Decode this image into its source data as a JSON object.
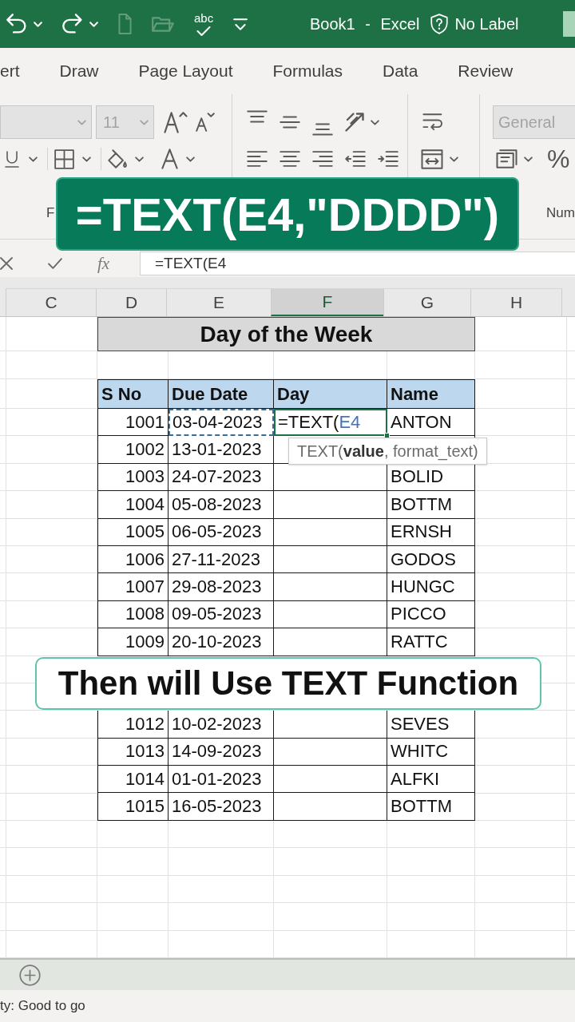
{
  "title_bar": {
    "quick_access": [
      {
        "kind": "undo",
        "disabled": false
      },
      {
        "kind": "redo",
        "disabled": false
      },
      {
        "kind": "new",
        "disabled": true
      },
      {
        "kind": "open",
        "disabled": true
      },
      {
        "kind": "spelling",
        "label": "abc",
        "disabled": false
      },
      {
        "kind": "customize",
        "disabled": false
      }
    ],
    "title": "Book1 - Excel",
    "sensitivity_label": "No Label"
  },
  "ribbon": {
    "tabs": [
      {
        "label": "ert",
        "selected": false
      },
      {
        "label": "Draw",
        "selected": false
      },
      {
        "label": "Page Layout",
        "selected": false
      },
      {
        "label": "Formulas",
        "selected": false
      },
      {
        "label": "Data",
        "selected": false
      },
      {
        "label": "Review",
        "selected": false
      }
    ],
    "font_name": {
      "disabled": true
    },
    "font_size": {
      "value": "11",
      "disabled": true
    },
    "number_format": {
      "value": "General",
      "disabled": true
    },
    "percent_style": "%",
    "group_labels": [
      "F",
      "Num"
    ]
  },
  "formula_caption": "=TEXT(E4,\"DDDD\")",
  "formula_bar": {
    "insert_function": "fx",
    "value": "=TEXT(E4"
  },
  "columns": [
    {
      "label": "C",
      "selected": false
    },
    {
      "label": "D",
      "selected": false
    },
    {
      "label": "E",
      "selected": false
    },
    {
      "label": "F",
      "selected": true
    },
    {
      "label": "G",
      "selected": false
    },
    {
      "label": "H",
      "selected": false
    }
  ],
  "sheet": {
    "title": "Day of the Week",
    "headers": [
      "S No",
      "Due Date",
      "Day",
      "Name"
    ],
    "rows": [
      {
        "s_no": "1001",
        "due_date": "03-04-2023",
        "referenced": true,
        "active": true,
        "day_formula": "=TEXT(",
        "day_reference": "E4",
        "name": "ANTON"
      },
      {
        "s_no": "1002",
        "due_date": "13-01-2023",
        "referenced": false,
        "active": false
      },
      {
        "s_no": "1003",
        "due_date": "24-07-2023",
        "referenced": false,
        "active": false,
        "name": "BOLID"
      },
      {
        "s_no": "1004",
        "due_date": "05-08-2023",
        "referenced": false,
        "active": false,
        "name": "BOTTM"
      },
      {
        "s_no": "1005",
        "due_date": "06-05-2023",
        "referenced": false,
        "active": false,
        "name": "ERNSH"
      },
      {
        "s_no": "1006",
        "due_date": "27-11-2023",
        "referenced": false,
        "active": false,
        "name": "GODOS"
      },
      {
        "s_no": "1007",
        "due_date": "29-08-2023",
        "referenced": false,
        "active": false,
        "name": "HUNGC"
      },
      {
        "s_no": "1008",
        "due_date": "09-05-2023",
        "referenced": false,
        "active": false,
        "name": "PICCO"
      },
      {
        "s_no": "1009",
        "due_date": "20-10-2023",
        "referenced": false,
        "active": false,
        "name": "RATTC"
      },
      {
        "s_no": "1012",
        "due_date": "10-02-2023",
        "referenced": false,
        "active": false,
        "name": "SEVES"
      },
      {
        "s_no": "1013",
        "due_date": "14-09-2023",
        "referenced": false,
        "active": false,
        "name": "WHITC"
      },
      {
        "s_no": "1014",
        "due_date": "01-01-2023",
        "referenced": false,
        "active": false,
        "name": "ALFKI"
      },
      {
        "s_no": "1015",
        "due_date": "16-05-2023",
        "referenced": false,
        "active": false,
        "name": "BOTTM"
      }
    ],
    "tooltip": "TEXT(**value**, format_text)"
  },
  "caption": "Then will Use TEXT Function",
  "status_bar": {
    "text": "ty: Good to go"
  }
}
